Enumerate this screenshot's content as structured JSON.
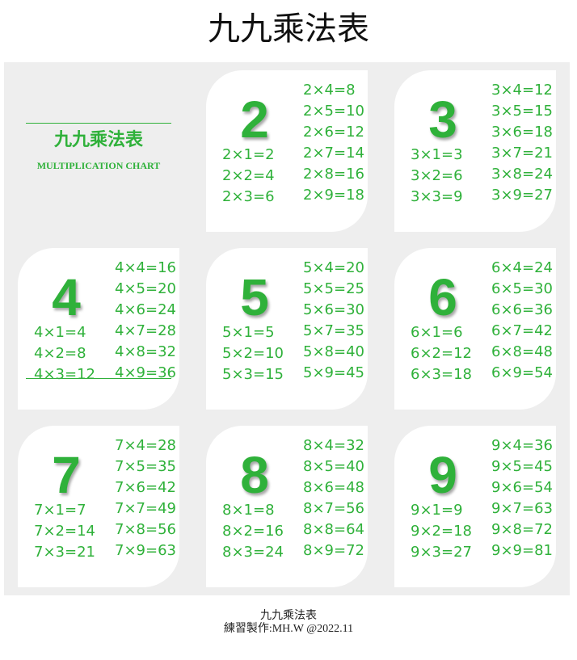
{
  "header": {
    "title": "九九乘法表"
  },
  "cover": {
    "title": "九九乘法表",
    "subtitle": "MULTIPLICATION CHART"
  },
  "colors": {
    "accent": "#2fb13a",
    "board": "#eeeeee",
    "card": "#ffffff"
  },
  "tables": [
    {
      "number": "2",
      "left": [
        "2×1=2",
        "2×2=4",
        "2×3=6"
      ],
      "right": [
        "2×4=8",
        "2×5=10",
        "2×6=12",
        "2×7=14",
        "2×8=16",
        "2×9=18"
      ]
    },
    {
      "number": "3",
      "left": [
        "3×1=3",
        "3×2=6",
        "3×3=9"
      ],
      "right": [
        "3×4=12",
        "3×5=15",
        "3×6=18",
        "3×7=21",
        "3×8=24",
        "3×9=27"
      ]
    },
    {
      "number": "4",
      "left": [
        "4×1=4",
        "4×2=8",
        "4×3=12"
      ],
      "right": [
        "4×4=16",
        "4×5=20",
        "4×6=24",
        "4×7=28",
        "4×8=32",
        "4×9=36"
      ]
    },
    {
      "number": "5",
      "left": [
        "5×1=5",
        "5×2=10",
        "5×3=15"
      ],
      "right": [
        "5×4=20",
        "5×5=25",
        "5×6=30",
        "5×7=35",
        "5×8=40",
        "5×9=45"
      ]
    },
    {
      "number": "6",
      "left": [
        "6×1=6",
        "6×2=12",
        "6×3=18"
      ],
      "right": [
        "6×4=24",
        "6×5=30",
        "6×6=36",
        "6×7=42",
        "6×8=48",
        "6×9=54"
      ]
    },
    {
      "number": "7",
      "left": [
        "7×1=7",
        "7×2=14",
        "7×3=21"
      ],
      "right": [
        "7×4=28",
        "7×5=35",
        "7×6=42",
        "7×7=49",
        "7×8=56",
        "7×9=63"
      ]
    },
    {
      "number": "8",
      "left": [
        "8×1=8",
        "8×2=16",
        "8×3=24"
      ],
      "right": [
        "8×4=32",
        "8×5=40",
        "8×6=48",
        "8×7=56",
        "8×8=64",
        "8×9=72"
      ]
    },
    {
      "number": "9",
      "left": [
        "9×1=9",
        "9×2=18",
        "9×3=27"
      ],
      "right": [
        "9×4=36",
        "9×5=45",
        "9×6=54",
        "9×7=63",
        "9×8=72",
        "9×9=81"
      ]
    }
  ],
  "footer": {
    "line1": "九九乘法表",
    "line2": "練習製作:MH.W @2022.11"
  }
}
